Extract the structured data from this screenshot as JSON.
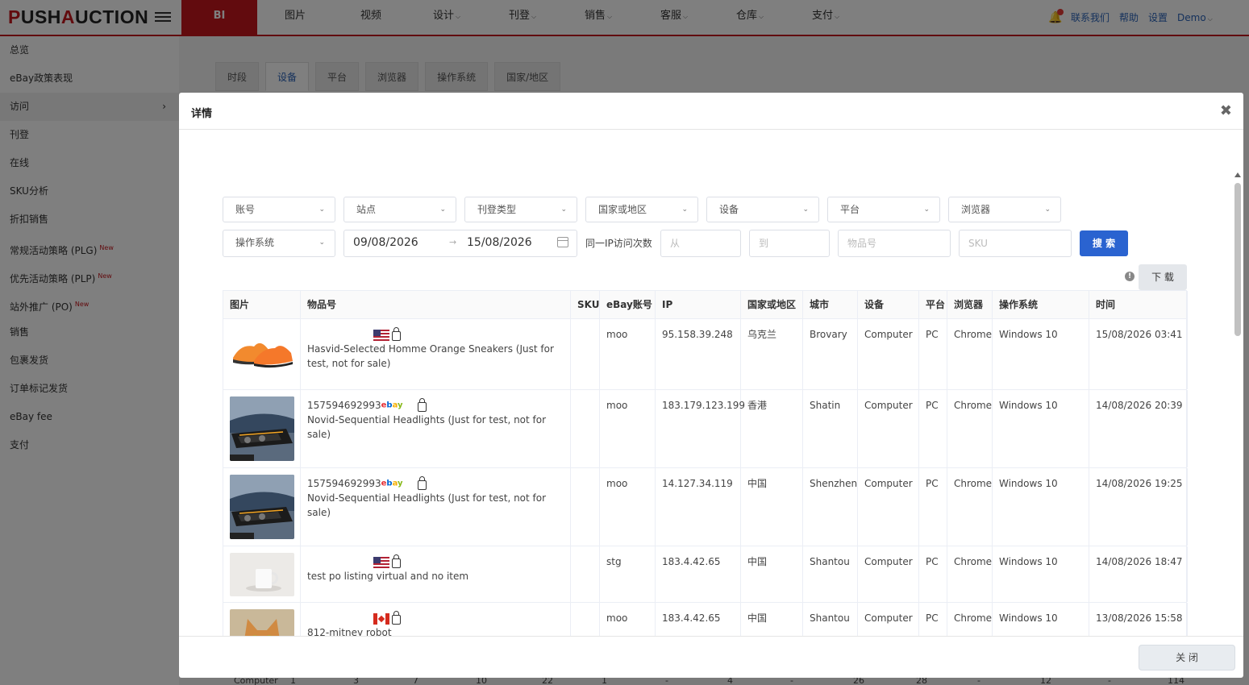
{
  "topbar": {
    "logo_a": "P",
    "logo_b": "USH",
    "logo_c": "A",
    "logo_d": "UCTION",
    "nav": [
      {
        "label": "BI",
        "active": true,
        "caret": false
      },
      {
        "label": "图片",
        "caret": false
      },
      {
        "label": "视频",
        "caret": false
      },
      {
        "label": "设计",
        "caret": true
      },
      {
        "label": "刊登",
        "caret": true
      },
      {
        "label": "销售",
        "caret": true
      },
      {
        "label": "客服",
        "caret": true
      },
      {
        "label": "仓库",
        "caret": true
      },
      {
        "label": "支付",
        "caret": true
      }
    ],
    "contact": "联系我们",
    "help": "帮助",
    "settings": "设置",
    "user": "Demo"
  },
  "sidebar": {
    "items": [
      {
        "label": "总览"
      },
      {
        "label": "eBay政策表现"
      },
      {
        "label": "访问",
        "active": true
      },
      {
        "label": "刊登"
      },
      {
        "label": "在线"
      },
      {
        "label": "SKU分析"
      },
      {
        "label": "折扣销售"
      },
      {
        "label": "常规活动策略 (PLG)",
        "badge": "New"
      },
      {
        "label": "优先活动策略 (PLP)",
        "badge": "New"
      },
      {
        "label": "站外推广 (PO)",
        "badge": "New"
      },
      {
        "label": "销售"
      },
      {
        "label": "包裹发货"
      },
      {
        "label": "订单标记发货"
      },
      {
        "label": "eBay fee"
      },
      {
        "label": "支付"
      }
    ]
  },
  "main": {
    "tabs": [
      {
        "label": "时段"
      },
      {
        "label": "设备",
        "active": true
      },
      {
        "label": "平台"
      },
      {
        "label": "浏览器"
      },
      {
        "label": "操作系统"
      },
      {
        "label": "国家/地区"
      }
    ],
    "bg_row": [
      "Computer",
      "1",
      "3",
      "7",
      "10",
      "22",
      "1",
      "-",
      "4",
      "-",
      "26",
      "28",
      "-",
      "12",
      "-",
      "114"
    ]
  },
  "modal": {
    "title": "详情",
    "filters_row1": [
      "账号",
      "站点",
      "刊登类型",
      "国家或地区",
      "设备",
      "平台",
      "浏览器"
    ],
    "filter_os": "操作系统",
    "date_from": "09/08/2026",
    "date_to": "15/08/2026",
    "ip_label": "同一IP访问次数",
    "ph_from": "从",
    "ph_to": "到",
    "ph_item": "物品号",
    "ph_sku": "SKU",
    "search": "搜 索",
    "download": "下 载",
    "close_btn": "关 闭",
    "headers": [
      "图片",
      "物品号",
      "SKU",
      "eBay账号",
      "IP",
      "国家或地区",
      "城市",
      "设备",
      "平台",
      "浏览器",
      "操作系统",
      "时间"
    ],
    "rows": [
      {
        "thumb": "orange-sneakers",
        "item_no": "",
        "flag": "us",
        "ebay_logo": false,
        "title": "Hasvid-Selected Homme Orange Sneakers (Just for test, not for sale)",
        "sku": "",
        "account": "moo",
        "ip": "95.158.39.248",
        "country": "乌克兰",
        "city": "Brovary",
        "device": "Computer",
        "platform": "PC",
        "browser": "Chrome",
        "os": "Windows 10",
        "time": "15/08/2026 03:41"
      },
      {
        "thumb": "car-headlights",
        "item_no": "157594692993",
        "flag": "",
        "ebay_logo": true,
        "title": "Novid-Sequential Headlights (Just for test, not for sale)",
        "sku": "",
        "account": "moo",
        "ip": "183.179.123.199",
        "country": "香港",
        "city": "Shatin",
        "device": "Computer",
        "platform": "PC",
        "browser": "Chrome",
        "os": "Windows 10",
        "time": "14/08/2026 20:39"
      },
      {
        "thumb": "car-headlights",
        "item_no": "157594692993",
        "flag": "",
        "ebay_logo": true,
        "title": "Novid-Sequential Headlights (Just for test, not for sale)",
        "sku": "",
        "account": "moo",
        "ip": "14.127.34.119",
        "country": "中国",
        "city": "Shenzhen",
        "device": "Computer",
        "platform": "PC",
        "browser": "Chrome",
        "os": "Windows 10",
        "time": "14/08/2026 19:25"
      },
      {
        "thumb": "white-mug",
        "item_no": "",
        "flag": "us",
        "ebay_logo": false,
        "title": "test po listing virtual and no item",
        "sku": "",
        "account": "stg",
        "ip": "183.4.42.65",
        "country": "中国",
        "city": "Shantou",
        "device": "Computer",
        "platform": "PC",
        "browser": "Chrome",
        "os": "Windows 10",
        "time": "14/08/2026 18:47"
      },
      {
        "thumb": "cat",
        "item_no": "",
        "flag": "ca",
        "ebay_logo": false,
        "title": "812-mitney robot",
        "sku": "",
        "account": "moo",
        "ip": "183.4.42.65",
        "country": "中国",
        "city": "Shantou",
        "device": "Computer",
        "platform": "PC",
        "browser": "Chrome",
        "os": "Windows 10",
        "time": "13/08/2026 15:58"
      }
    ]
  },
  "colors": {
    "brand": "#c4161c",
    "primary": "#2a63d0",
    "link": "#2a63b8"
  }
}
